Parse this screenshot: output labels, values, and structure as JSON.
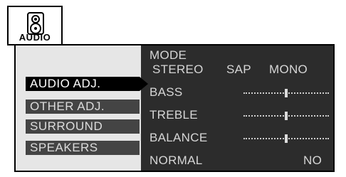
{
  "icon_tab": {
    "label": "AUDIO",
    "icon": "speaker-icon"
  },
  "left_menu": [
    {
      "label": "AUDIO ADJ.",
      "selected": true
    },
    {
      "label": "OTHER ADJ.",
      "selected": false
    },
    {
      "label": "SURROUND",
      "selected": false
    },
    {
      "label": "SPEAKERS",
      "selected": false
    }
  ],
  "settings": {
    "mode": {
      "label": "MODE",
      "options": [
        "STEREO",
        "SAP",
        "MONO"
      ]
    },
    "bass": {
      "label": "BASS",
      "level": 0.5
    },
    "treble": {
      "label": "TREBLE",
      "level": 0.5
    },
    "balance": {
      "label": "BALANCE",
      "level": 0.5
    },
    "normal": {
      "label": "NORMAL",
      "value": "NO"
    }
  },
  "colors": {
    "panel_bg": "#e6e6e6",
    "right_bg": "#2c2c2c",
    "selected_bg": "#000000",
    "menu_bg": "#444444"
  }
}
